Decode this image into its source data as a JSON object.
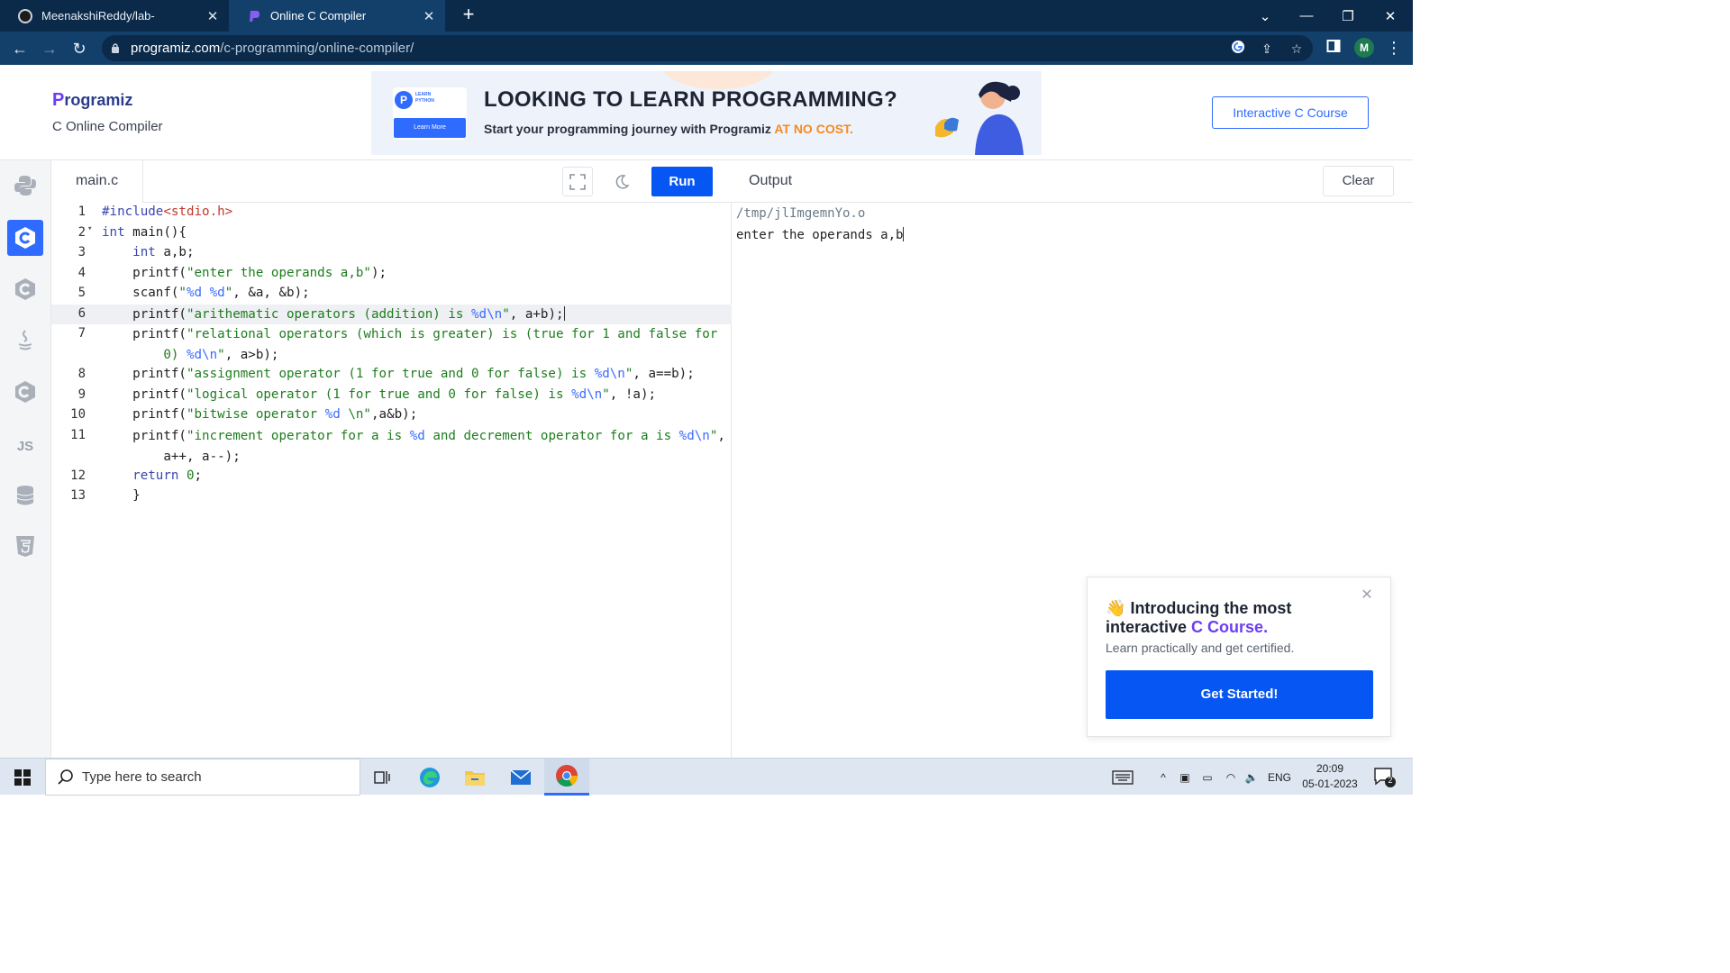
{
  "browser": {
    "tabs": [
      {
        "title": "MeenakshiReddy/lab-",
        "active": false
      },
      {
        "title": "Online C Compiler",
        "active": true
      }
    ],
    "url_host": "programiz.com",
    "url_path": "/c-programming/online-compiler/",
    "profile_initial": "M"
  },
  "header": {
    "logo_first": "P",
    "logo_rest": "rogramiz",
    "subtitle": "C Online Compiler",
    "course_button": "Interactive C Course",
    "banner": {
      "badge_label": "LEARN\nPYTHON",
      "badge_button": "Learn More",
      "headline": "LOOKING TO LEARN PROGRAMMING?",
      "sub_prefix": "Start your programming journey with Programiz ",
      "sub_highlight": "AT NO COST."
    }
  },
  "languages": [
    "python-icon",
    "c-icon",
    "cpp-icon",
    "java-icon",
    "csharp-icon",
    "js-icon",
    "sql-icon",
    "html-icon"
  ],
  "editor": {
    "file_name": "main.c",
    "run_label": "Run",
    "active_line": 6,
    "line_numbers": [
      "1",
      "2",
      "3",
      "4",
      "5",
      "6",
      "7",
      "8",
      "9",
      "10",
      "11",
      "12",
      "13"
    ]
  },
  "output": {
    "title": "Output",
    "clear_label": "Clear",
    "path_line": "/tmp/jlImgemnYo.o",
    "stdout_line": "enter the operands a,b"
  },
  "popup": {
    "emoji": "👋",
    "title_prefix": "Introducing the most interactive ",
    "title_accent": "C Course.",
    "description": "Learn practically and get certified.",
    "cta": "Get Started!"
  },
  "taskbar": {
    "search_placeholder": "Type here to search",
    "language": "ENG",
    "time": "20:09",
    "date": "05-01-2023",
    "notification_count": "2"
  }
}
